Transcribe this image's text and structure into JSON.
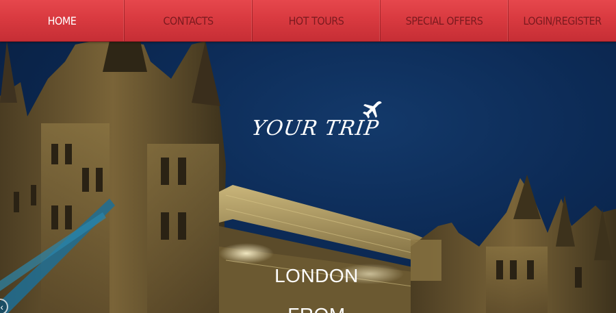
{
  "nav": {
    "items": [
      {
        "label": "HOME",
        "active": true
      },
      {
        "label": "CONTACTS",
        "active": false
      },
      {
        "label": "HOT TOURS",
        "active": false
      },
      {
        "label": "SPECIAL OFFERS",
        "active": false
      },
      {
        "label": "LOGIN/REGISTER",
        "active": false
      }
    ]
  },
  "hero": {
    "brand": "YOUR TRIP",
    "brand_icon": "airplane-icon",
    "city": "LONDON",
    "subtitle": "FROM",
    "prev_icon": "chevron-left-icon",
    "prev_glyph": "‹"
  },
  "colors": {
    "nav_red": "#d93a40",
    "nav_text": "#7b1a1f",
    "active_text": "#ffffff",
    "sky": "#0c2a55",
    "stone": "#6e5a34"
  }
}
